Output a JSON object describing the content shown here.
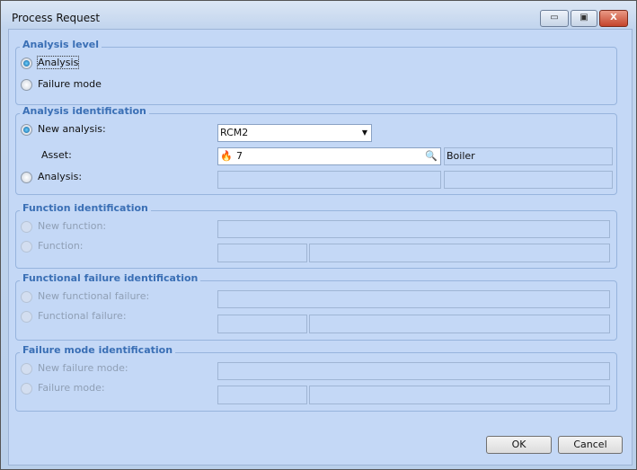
{
  "window": {
    "title": "Process Request",
    "minimize": "▭",
    "maximize": "▣",
    "close": "X"
  },
  "analysis_level": {
    "title": "Analysis level",
    "options": [
      {
        "label": "Analysis",
        "selected": true
      },
      {
        "label": "Failure mode",
        "selected": false
      }
    ]
  },
  "analysis_identification": {
    "title": "Analysis identification",
    "new_analysis_label": "New analysis:",
    "new_analysis_value": "RCM2",
    "asset_label": "Asset:",
    "asset_value": "7",
    "asset_name": "Boiler",
    "analysis_label": "Analysis:"
  },
  "function_identification": {
    "title": "Function identification",
    "new_label": "New function:",
    "existing_label": "Function:"
  },
  "functional_failure_identification": {
    "title": "Functional failure identification",
    "new_label": "New functional failure:",
    "existing_label": "Functional failure:"
  },
  "failure_mode_identification": {
    "title": "Failure mode identification",
    "new_label": "New failure mode:",
    "existing_label": "Failure mode:"
  },
  "buttons": {
    "ok": "OK",
    "cancel": "Cancel"
  }
}
